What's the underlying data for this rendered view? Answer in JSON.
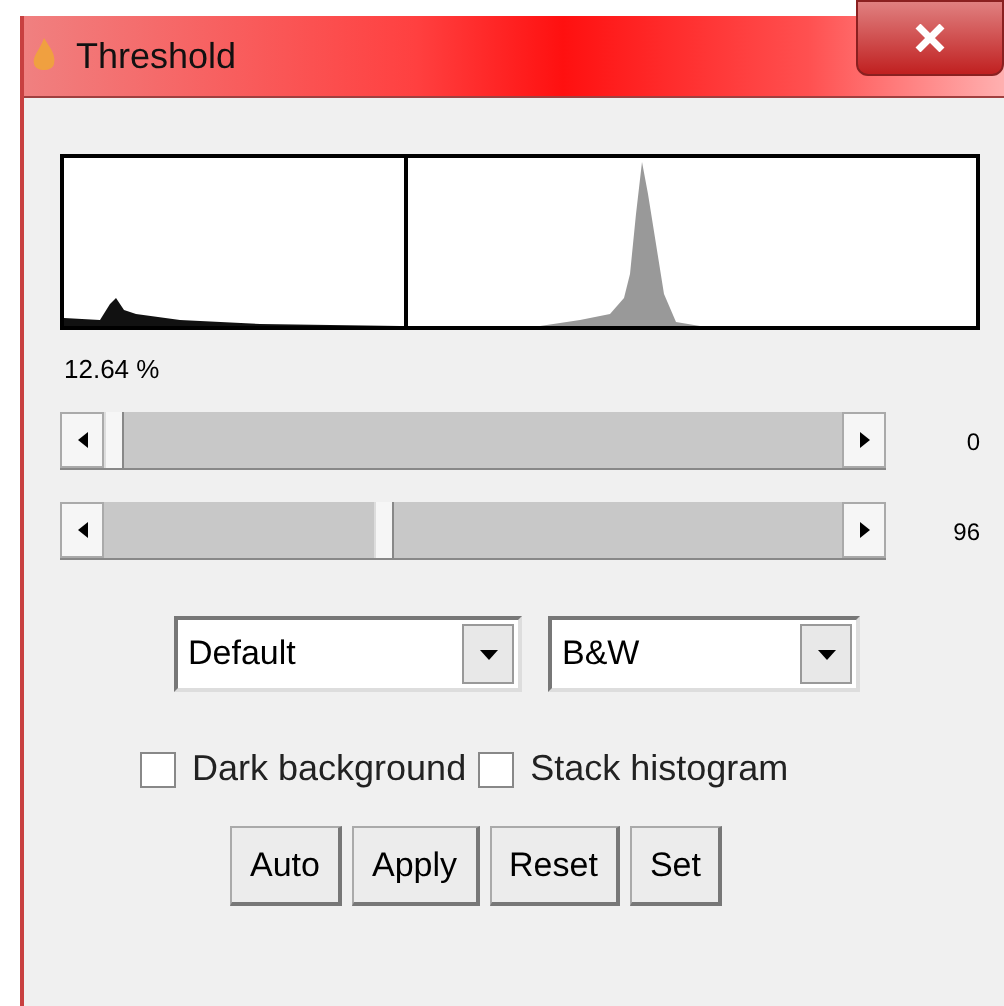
{
  "window": {
    "title": "Threshold"
  },
  "percent": "12.64 %",
  "sliders": [
    {
      "level": 0,
      "reading": "0"
    },
    {
      "level": 0.376,
      "reading": "96"
    }
  ],
  "dropdowns": [
    {
      "value": "Default"
    },
    {
      "value": "B&W"
    }
  ],
  "checkboxes": [
    {
      "label": "Dark background",
      "checked": false
    },
    {
      "label": "Stack histogram",
      "checked": false
    }
  ],
  "buttons": [
    "Auto",
    "Apply",
    "Reset",
    "Set"
  ]
}
